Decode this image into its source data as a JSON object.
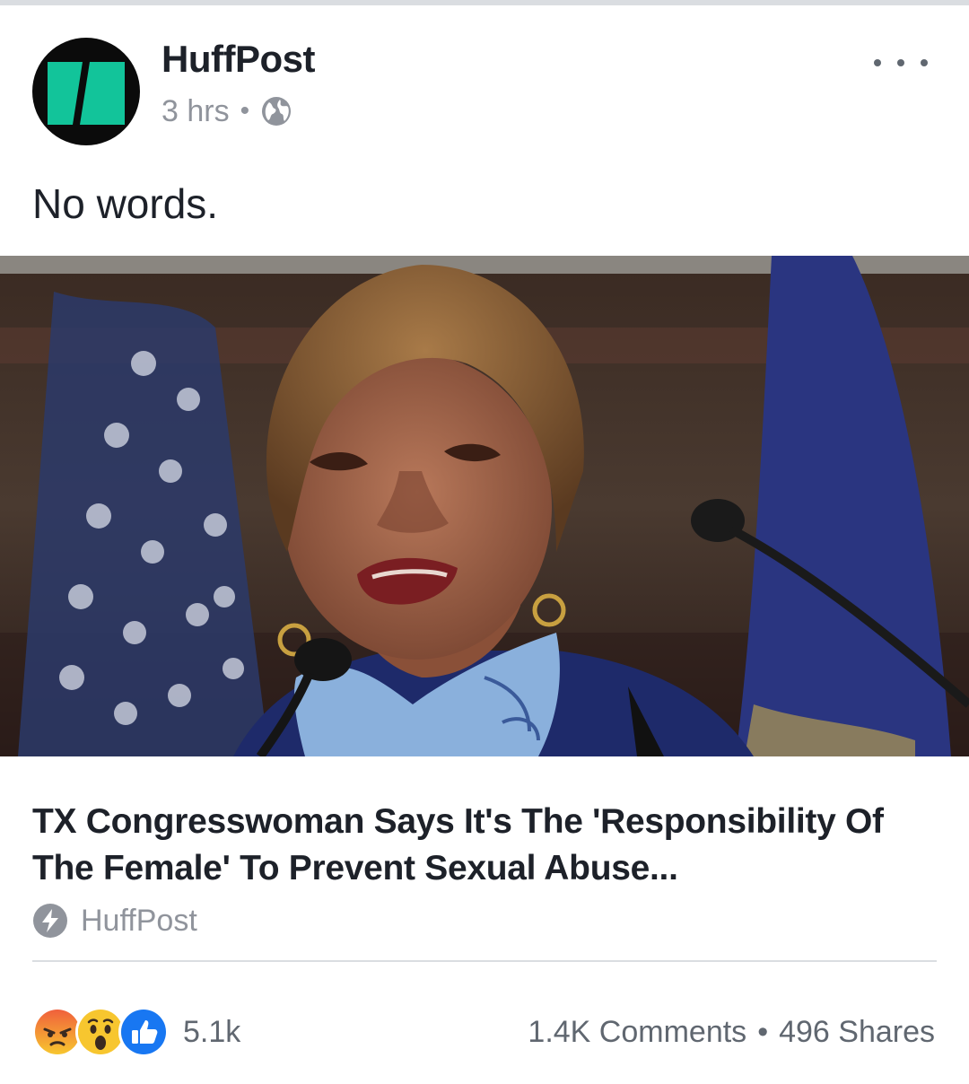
{
  "post": {
    "page_name": "HuffPost",
    "time": "3 hrs",
    "separator": "•",
    "audience_icon": "globe-icon",
    "more_icon": "more-options-icon",
    "text": "No words."
  },
  "link_preview": {
    "image_alt": "Congresswoman speaking at a microphone in front of flags",
    "headline": "TX Congresswoman Says It's The 'Responsibility Of The Female' To Prevent Sexual Abuse...",
    "source": "HuffPost",
    "source_icon": "instant-article-bolt-icon"
  },
  "engagement": {
    "reactions": [
      "angry",
      "wow",
      "like"
    ],
    "reaction_count": "5.1k",
    "comments": "1.4K Comments",
    "separator": "•",
    "shares": "496 Shares"
  },
  "colors": {
    "brand_teal": "#12c49a",
    "text_primary": "#1d2129",
    "text_secondary": "#90949c",
    "like_blue": "#1877f2",
    "reaction_yellow": "#f7c62f",
    "angry_red": "#f0603c"
  }
}
